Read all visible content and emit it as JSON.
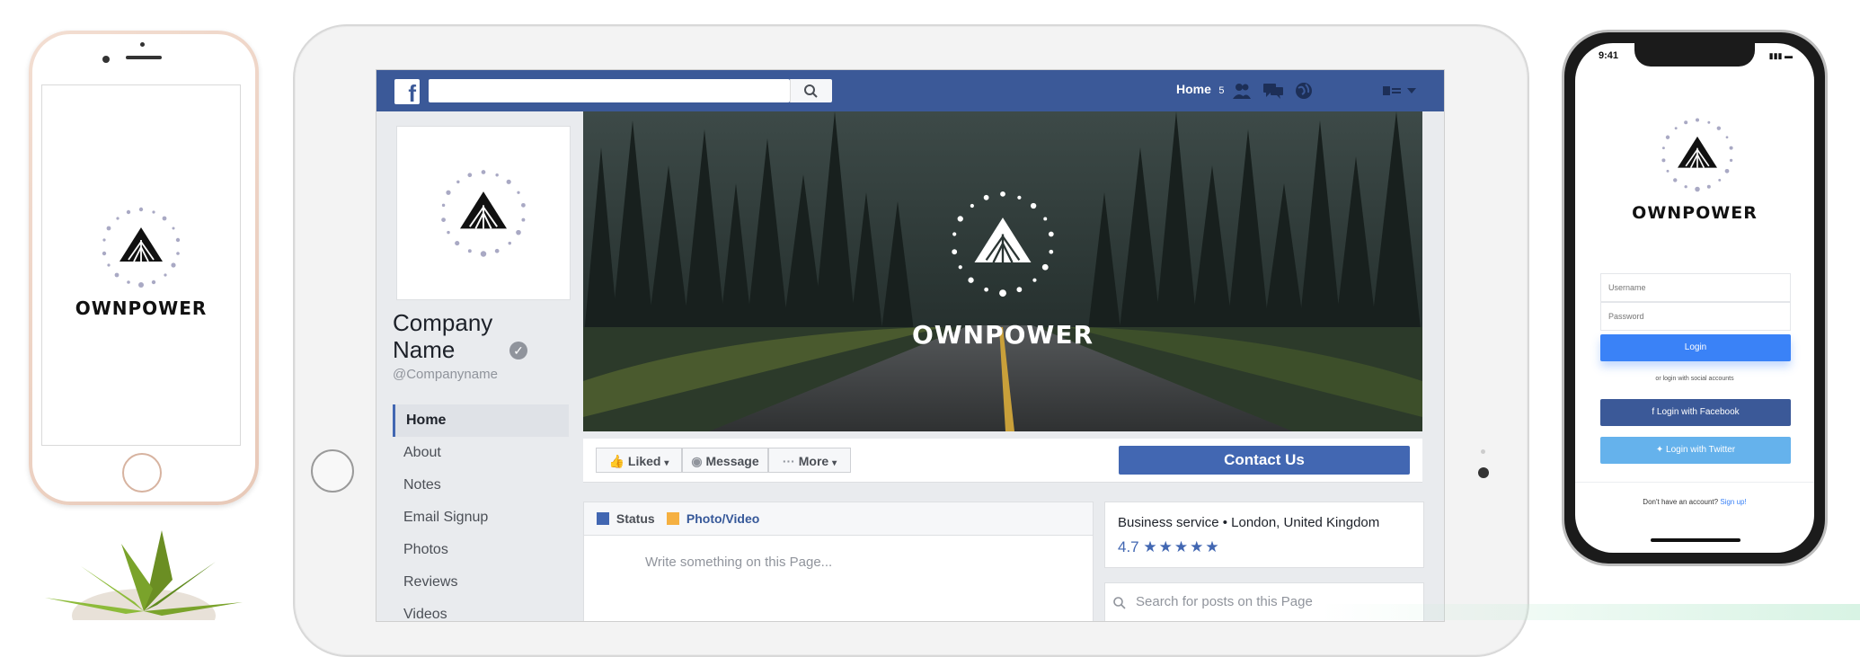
{
  "brand": {
    "name": "OWNPOWER"
  },
  "phone_left": {
    "brand_word": "OWNPOWER"
  },
  "facebook": {
    "logo_letter": "f",
    "search_placeholder": "",
    "top_nav": {
      "home_label": "Home",
      "home_count": "5"
    },
    "page": {
      "company_name": "Company Name",
      "handle": "@Companyname",
      "verified_mark": "✓"
    },
    "sidebar_items": [
      {
        "label": "Home",
        "active": true
      },
      {
        "label": "About",
        "active": false
      },
      {
        "label": "Notes",
        "active": false
      },
      {
        "label": "Email Signup",
        "active": false
      },
      {
        "label": "Photos",
        "active": false
      },
      {
        "label": "Reviews",
        "active": false
      },
      {
        "label": "Videos",
        "active": false
      }
    ],
    "cover": {
      "brand_word": "OWNPOWER"
    },
    "actions": {
      "liked": "Liked",
      "message": "Message",
      "more_prefix": "···",
      "more": "More",
      "contact": "Contact Us"
    },
    "composer": {
      "status": "Status",
      "photo_video": "Photo/Video",
      "placeholder": "Write something on this Page..."
    },
    "info": {
      "category_location": "Business service • London, United Kingdom",
      "rating": "4.7",
      "stars": "★★★★★"
    },
    "search_posts": {
      "placeholder": "Search for posts on this Page"
    }
  },
  "phone_right": {
    "status_time": "9:41",
    "brand_word": "OWNPOWER",
    "username_placeholder": "Username",
    "password_placeholder": "Password",
    "login_label": "Login",
    "social_note": "or login with social accounts",
    "facebook_login": "Login with Facebook",
    "twitter_login": "Login with Twitter",
    "signup_prompt": "Don't have an account?",
    "signup_link": "Sign up!"
  },
  "colors": {
    "facebook_blue": "#3b5998",
    "facebook_button": "#4267b2",
    "login_button": "#3a82f7",
    "twitter": "#65b2ec"
  }
}
